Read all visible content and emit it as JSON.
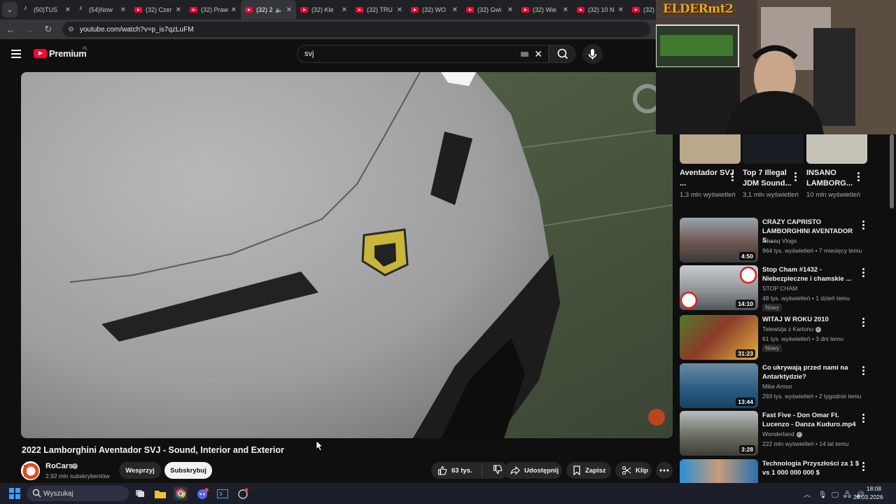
{
  "browser": {
    "tabs": [
      {
        "label": "(50)TUS",
        "icon": "tiktok-icon"
      },
      {
        "label": "(54)Now",
        "icon": "tiktok-icon"
      },
      {
        "label": "(32) Czer",
        "icon": "youtube-icon"
      },
      {
        "label": "(32) Praw",
        "icon": "youtube-icon"
      },
      {
        "label": "(32) 2",
        "icon": "youtube-icon",
        "active": true,
        "audio": true
      },
      {
        "label": "(32) Kle",
        "icon": "youtube-icon"
      },
      {
        "label": "(32) TRU",
        "icon": "youtube-icon"
      },
      {
        "label": "(32) WO",
        "icon": "youtube-icon"
      },
      {
        "label": "(32) Gwi",
        "icon": "youtube-icon"
      },
      {
        "label": "(32) Wie",
        "icon": "youtube-icon"
      },
      {
        "label": "(32) 10 N",
        "icon": "youtube-icon"
      },
      {
        "label": "(32) ",
        "icon": "youtube-icon"
      }
    ],
    "url": "youtube.com/watch?v=p_is7qzLuFM"
  },
  "youtube": {
    "logo_text": "Premium",
    "region": "PL",
    "search_value": "svj"
  },
  "video": {
    "title": "2022 Lamborghini Aventador SVJ - Sound, Interior and Exterior",
    "channel": "RoCars",
    "subscribers": "2,92 mln subskrybentów",
    "support_label": "Wesprzyj",
    "subscribe_label": "Subskrybuj",
    "likes": "63 tys.",
    "share_label": "Udostępnij",
    "save_label": "Zapisz",
    "clip_label": "Klip"
  },
  "webcam": {
    "overlay_logo": "ELDERmt2"
  },
  "shorts": [
    {
      "title": "Aventador SVJ ...",
      "views": "1,3 mln wyświetleń"
    },
    {
      "title": "Top 7 Illegal JDM Sound...",
      "views": "3,1 mln wyświetleń"
    },
    {
      "title": "INSANO LAMBORG...",
      "views": "10 mln wyświetleń"
    }
  ],
  "recommended": [
    {
      "title": "CRAZY CAPRISTO LAMBORGHINI AVENTADOR S...",
      "channel": "Ishaaq Vlogs",
      "meta": "964 tys. wyświetleń • 7 miesięcy temu",
      "duration": "4:50",
      "verified": false,
      "badge": ""
    },
    {
      "title": "Stop Cham #1432 - Niebezpieczne i chamskie ...",
      "channel": "STOP CHAM",
      "meta": "48 tys. wyświetleń • 1 dzień temu",
      "duration": "14:10",
      "verified": false,
      "badge": "Nowy"
    },
    {
      "title": "WITAJ W ROKU 2010",
      "channel": "Telewizja z Kartonu",
      "meta": "61 tys. wyświetleń • 3 dni temu",
      "duration": "31:23",
      "verified": true,
      "badge": "Nowy"
    },
    {
      "title": "Co ukrywają przed nami na Antarktydzie?",
      "channel": "Mike Armor",
      "meta": "293 tys. wyświetleń • 2 tygodnie temu",
      "duration": "13:44",
      "verified": false,
      "badge": ""
    },
    {
      "title": "Fast Five - Don Omar Ft. Lucenzo - Danza Kuduro.mp4",
      "channel": "Wonderland",
      "meta": "222 mln wyświetleń • 14 lat temu",
      "duration": "3:28",
      "verified": true,
      "badge": ""
    },
    {
      "title": "Technologia Przyszłości za 1 $ vs 1 000 000 000 $",
      "channel": "",
      "meta": "",
      "duration": "",
      "verified": false,
      "badge": ""
    }
  ],
  "taskbar": {
    "search_placeholder": "Wyszukaj",
    "time": "18:08",
    "date": "26.03.2026"
  },
  "colors": {
    "background": "#0f0f0f",
    "yt_red": "#ff0033",
    "pill": "#272727",
    "accent_orange": "#f0a51a"
  }
}
